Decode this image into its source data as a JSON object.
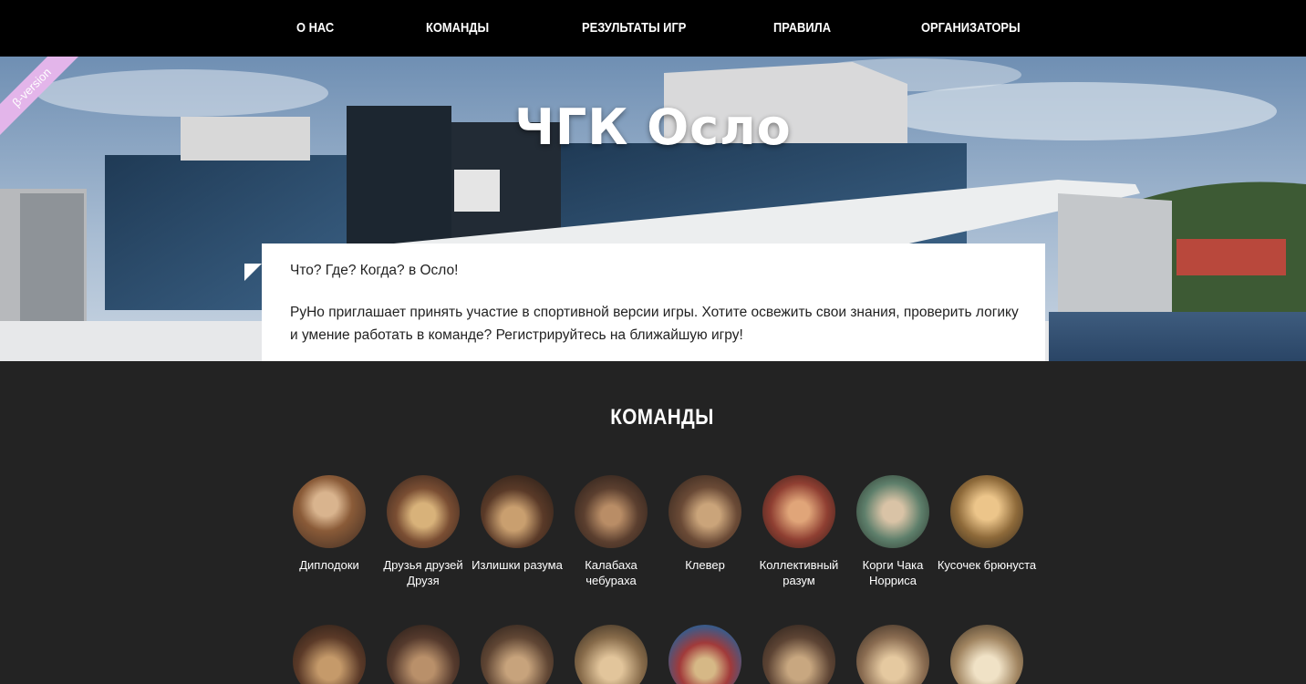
{
  "nav": {
    "items": [
      {
        "label": "О НАС"
      },
      {
        "label": "КОМАНДЫ"
      },
      {
        "label": "РЕЗУЛЬТАТЫ ИГР"
      },
      {
        "label": "ПРАВИЛА"
      },
      {
        "label": "ОРГАНИЗАТОРЫ"
      }
    ]
  },
  "hero": {
    "title": "ЧГК Осло",
    "beta_label": "β-version"
  },
  "intro": {
    "line1": "Что? Где? Когда? в Осло!",
    "line2": "РуНо приглашает принять участие в спортивной версии игры. Хотите освежить свои знания, проверить логику и умение работать в команде? Регистрируйтесь на ближайшую игру!"
  },
  "teams": {
    "heading": "КОМАНДЫ",
    "row1": [
      {
        "name": "Диплодоки"
      },
      {
        "name": "Друзья друзей Друзя"
      },
      {
        "name": "Излишки разума"
      },
      {
        "name": "Калабаха чебураха"
      },
      {
        "name": "Клевер"
      },
      {
        "name": "Коллективный разум"
      },
      {
        "name": "Корги Чака Норриса"
      },
      {
        "name": "Кусочек брюнуста"
      }
    ]
  },
  "colors": {
    "nav_bg": "#000000",
    "page_bg": "#232323",
    "ribbon": "#e3b5ea"
  }
}
